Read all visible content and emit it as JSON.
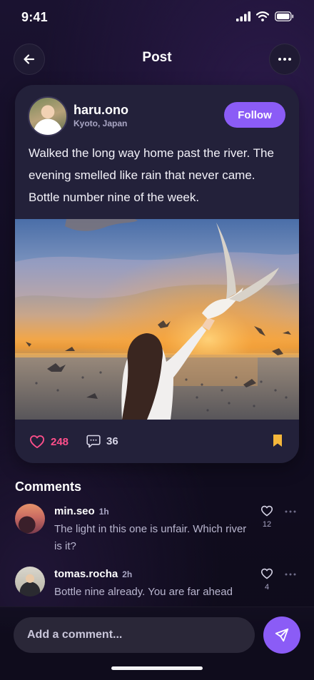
{
  "status_bar": {
    "time": "9:41"
  },
  "header": {
    "title": "Post"
  },
  "post": {
    "username": "haru.ono",
    "location": "Kyoto, Japan",
    "follow_label": "Follow",
    "text": "Walked the long way home past the river. The evening smelled like rain that never came. Bottle number nine of the week.",
    "likes": "248",
    "comments": "36",
    "liked": false,
    "bookmarked": true
  },
  "comments_section": {
    "heading": "Comments",
    "items": [
      {
        "username": "min.seo",
        "time": "1h",
        "text": "The light in this one is unfair. Which river is it?",
        "likes": "12"
      },
      {
        "username": "tomas.rocha",
        "time": "2h",
        "text": "Bottle nine already. You are far ahead",
        "likes": "4"
      }
    ]
  },
  "composer": {
    "placeholder": "Add a comment..."
  },
  "colors": {
    "accent": "#8b5cf6",
    "like": "#ff4f8b",
    "bookmark": "#f5b73b"
  }
}
